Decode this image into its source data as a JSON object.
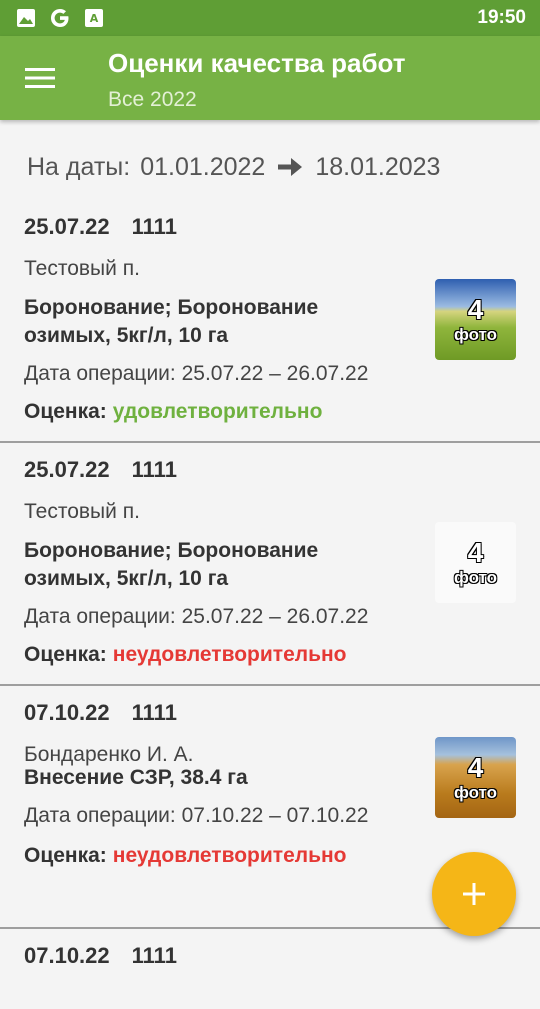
{
  "status_bar": {
    "time": "19:50",
    "icons": [
      "image-icon",
      "google-icon",
      "translate-icon"
    ]
  },
  "app_bar": {
    "title": "Оценки качества работ",
    "subtitle": "Все 2022",
    "menu_icon": "hamburger-menu-icon"
  },
  "date_range": {
    "label": "На даты:",
    "from": "01.01.2022",
    "to": "18.01.2023"
  },
  "items": [
    {
      "date": "25.07.22",
      "number": "1111",
      "person": "Тестовый п.",
      "operation": "Боронование; Боронование озимых, 5кг/л, 10 га",
      "dates": "Дата операции: 25.07.22 – 26.07.22",
      "grade_label": "Оценка:",
      "grade_value": "удовлетворительно",
      "grade_color": "#6fb13f",
      "photo_count": "4",
      "photo_label": "фото"
    },
    {
      "date": "25.07.22",
      "number": "1111",
      "person": "Тестовый п.",
      "operation": "Боронование; Боронование озимых, 5кг/л, 10 га",
      "dates": "Дата операции: 25.07.22 – 26.07.22",
      "grade_label": "Оценка:",
      "grade_value": "неудовлетворительно",
      "grade_color": "#e53935",
      "photo_count": "4",
      "photo_label": "фото"
    },
    {
      "date": "07.10.22",
      "number": "1111",
      "person": "Бондаренко И. А.",
      "operation": "Внесение СЗР, 38.4 га",
      "dates": "Дата операции: 07.10.22 – 07.10.22",
      "grade_label": "Оценка:",
      "grade_value": "неудовлетворительно",
      "grade_color": "#e53935",
      "photo_count": "4",
      "photo_label": "фото"
    },
    {
      "date": "07.10.22",
      "number": "1111"
    }
  ],
  "fab": {
    "icon": "plus-icon",
    "color": "#f5b617"
  },
  "colors": {
    "primary": "#77b245",
    "primary_dark": "#5f9e35",
    "ok": "#6fb13f",
    "bad": "#e53935"
  }
}
